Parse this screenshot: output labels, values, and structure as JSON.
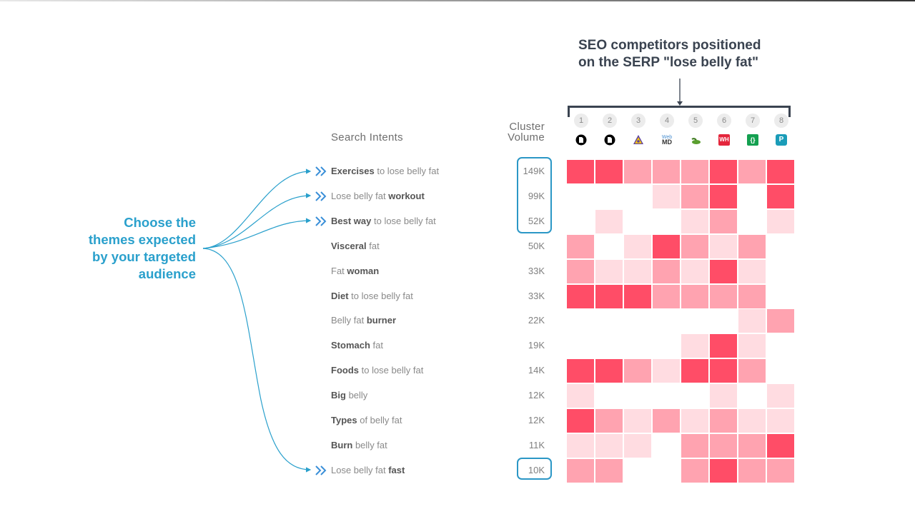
{
  "callout": {
    "line1": "SEO competitors positioned",
    "line2": "on the SERP \"lose belly fat\""
  },
  "annotation": {
    "lines": [
      "Choose the",
      "themes expected",
      "by your targeted",
      "audience"
    ],
    "color": "#2aa0cc"
  },
  "headers": {
    "intents": "Search Intents",
    "volume_line1": "Cluster",
    "volume_line2": "Volume"
  },
  "competitors": [
    {
      "rank": "1",
      "icon": "black-circle-doc-icon"
    },
    {
      "rank": "2",
      "icon": "black-circle-doc-icon"
    },
    {
      "rank": "3",
      "icon": "yellow-triangle-icon"
    },
    {
      "rank": "4",
      "icon": "webmd-logo-icon",
      "text": "MD"
    },
    {
      "rank": "5",
      "icon": "green-leaf-icon"
    },
    {
      "rank": "6",
      "icon": "red-wh-logo-icon",
      "text": "WH"
    },
    {
      "rank": "7",
      "icon": "green-bracket-logo-icon",
      "text": "{}"
    },
    {
      "rank": "8",
      "icon": "teal-p-logo-icon",
      "text": "P"
    }
  ],
  "intensity_colors": {
    "0": "#ffffff",
    "1": "#ffdce1",
    "2": "#ffa3b0",
    "3": "#ff4d67"
  },
  "rows": [
    {
      "parts": [
        {
          "t": "Exercises",
          "b": true
        },
        {
          "t": " to lose belly fat",
          "b": false
        }
      ],
      "volume": "149K",
      "selected": true,
      "cells": [
        3,
        3,
        2,
        2,
        2,
        3,
        2,
        3
      ]
    },
    {
      "parts": [
        {
          "t": "Lose belly fat ",
          "b": false
        },
        {
          "t": "workout",
          "b": true
        }
      ],
      "volume": "99K",
      "selected": true,
      "cells": [
        0,
        0,
        0,
        1,
        2,
        3,
        0,
        3
      ]
    },
    {
      "parts": [
        {
          "t": "Best way",
          "b": true
        },
        {
          "t": " to lose belly fat",
          "b": false
        }
      ],
      "volume": "52K",
      "selected": true,
      "cells": [
        0,
        1,
        0,
        0,
        1,
        2,
        0,
        1
      ]
    },
    {
      "parts": [
        {
          "t": "Visceral",
          "b": true
        },
        {
          "t": " fat",
          "b": false
        }
      ],
      "volume": "50K",
      "selected": false,
      "cells": [
        2,
        0,
        1,
        3,
        2,
        1,
        2,
        0
      ]
    },
    {
      "parts": [
        {
          "t": "Fat ",
          "b": false
        },
        {
          "t": "woman",
          "b": true
        }
      ],
      "volume": "33K",
      "selected": false,
      "cells": [
        2,
        1,
        1,
        2,
        1,
        3,
        1,
        0
      ]
    },
    {
      "parts": [
        {
          "t": "Diet",
          "b": true
        },
        {
          "t": " to lose belly fat",
          "b": false
        }
      ],
      "volume": "33K",
      "selected": false,
      "cells": [
        3,
        3,
        3,
        2,
        2,
        2,
        2,
        0
      ]
    },
    {
      "parts": [
        {
          "t": "Belly fat ",
          "b": false
        },
        {
          "t": "burner",
          "b": true
        }
      ],
      "volume": "22K",
      "selected": false,
      "cells": [
        0,
        0,
        0,
        0,
        0,
        0,
        1,
        2
      ]
    },
    {
      "parts": [
        {
          "t": "Stomach",
          "b": true
        },
        {
          "t": " fat",
          "b": false
        }
      ],
      "volume": "19K",
      "selected": false,
      "cells": [
        0,
        0,
        0,
        0,
        1,
        3,
        1,
        0
      ]
    },
    {
      "parts": [
        {
          "t": "Foods",
          "b": true
        },
        {
          "t": " to lose belly fat",
          "b": false
        }
      ],
      "volume": "14K",
      "selected": false,
      "cells": [
        3,
        3,
        2,
        1,
        3,
        3,
        2,
        0
      ]
    },
    {
      "parts": [
        {
          "t": "Big",
          "b": true
        },
        {
          "t": " belly",
          "b": false
        }
      ],
      "volume": "12K",
      "selected": false,
      "cells": [
        1,
        0,
        0,
        0,
        0,
        1,
        0,
        1
      ]
    },
    {
      "parts": [
        {
          "t": "Types",
          "b": true
        },
        {
          "t": " of belly fat",
          "b": false
        }
      ],
      "volume": "12K",
      "selected": false,
      "cells": [
        3,
        2,
        1,
        2,
        1,
        2,
        1,
        1
      ]
    },
    {
      "parts": [
        {
          "t": "Burn",
          "b": true
        },
        {
          "t": " belly fat",
          "b": false
        }
      ],
      "volume": "11K",
      "selected": false,
      "cells": [
        1,
        1,
        1,
        0,
        2,
        2,
        2,
        3
      ]
    },
    {
      "parts": [
        {
          "t": "Lose belly fat ",
          "b": false
        },
        {
          "t": "fast",
          "b": true
        }
      ],
      "volume": "10K",
      "selected": true,
      "cells": [
        2,
        2,
        0,
        0,
        2,
        3,
        2,
        2
      ]
    }
  ]
}
